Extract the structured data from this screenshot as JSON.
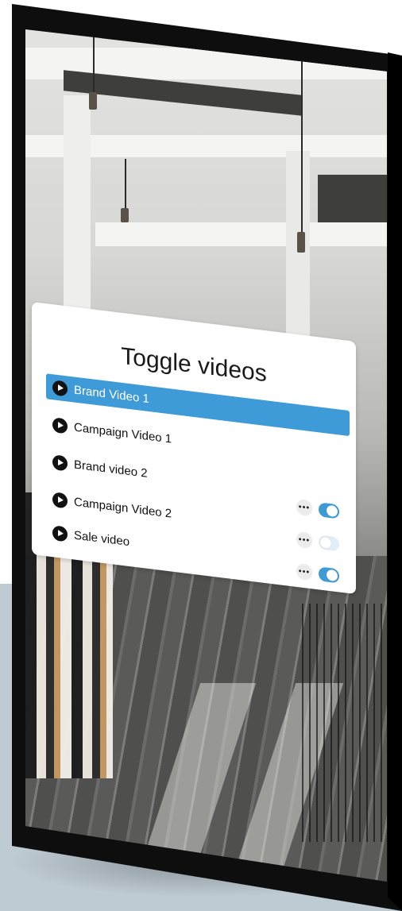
{
  "panel": {
    "title": "Toggle videos",
    "items": [
      {
        "label": "Brand Video 1",
        "selected": true
      },
      {
        "label": "Campaign Video 1",
        "selected": false
      },
      {
        "label": "Brand video 2",
        "selected": false
      },
      {
        "label": "Campaign Video 2",
        "selected": false
      },
      {
        "label": "Sale video",
        "selected": false
      }
    ],
    "controls": [
      {
        "more_label": "•••",
        "toggle_on": true
      },
      {
        "more_label": "•••",
        "toggle_on": false
      },
      {
        "more_label": "•••",
        "toggle_on": true
      }
    ]
  },
  "colors": {
    "accent": "#3f9ad8",
    "panel_bg": "#ffffff",
    "frame": "#0e0e0e",
    "backdrop": "#bfcbd3"
  },
  "icons": {
    "play": "play-icon",
    "more": "more-icon"
  }
}
